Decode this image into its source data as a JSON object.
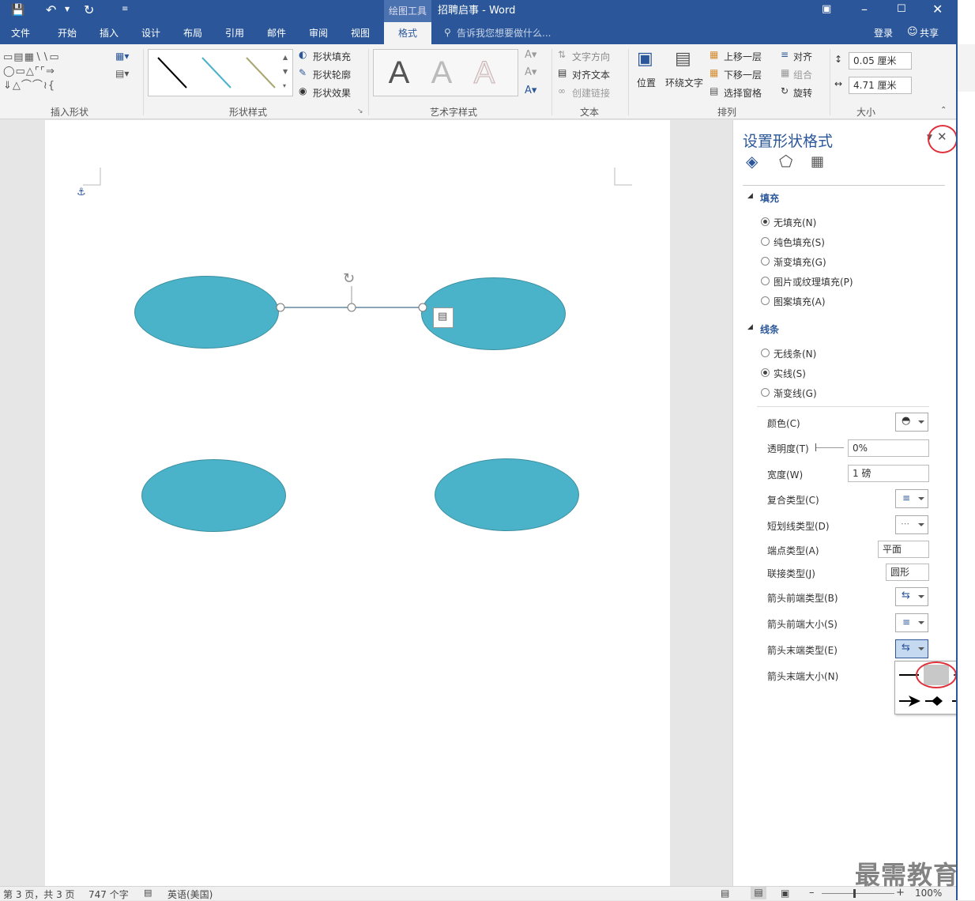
{
  "title": {
    "contextual_tool": "绘图工具",
    "document": "招聘启事 - Word"
  },
  "tabs": [
    "文件",
    "开始",
    "插入",
    "设计",
    "布局",
    "引用",
    "邮件",
    "审阅",
    "视图",
    "格式"
  ],
  "tell_me": "告诉我您想要做什么...",
  "account": {
    "login": "登录",
    "share": "共享"
  },
  "ribbon": {
    "groups": [
      "插入形状",
      "形状样式",
      "艺术字样式",
      "文本",
      "排列",
      "大小"
    ],
    "shape_fill": "形状填充",
    "shape_outline": "形状轮廓",
    "shape_effect": "形状效果",
    "text_direction": "文字方向",
    "align_text": "对齐文本",
    "create_link": "创建链接",
    "position": "位置",
    "wrap_text": "环绕文字",
    "bring_forward": "上移一层",
    "send_backward": "下移一层",
    "selection_pane": "选择窗格",
    "align": "对齐",
    "group": "组合",
    "rotate": "旋转",
    "height": "0.05 厘米",
    "width": "4.71 厘米",
    "wordart_letter": "A"
  },
  "pane": {
    "title": "设置形状格式",
    "fill_section": "填充",
    "fill_options": [
      "无填充(N)",
      "纯色填充(S)",
      "渐变填充(G)",
      "图片或纹理填充(P)",
      "图案填充(A)"
    ],
    "line_section": "线条",
    "line_options": [
      "无线条(N)",
      "实线(S)",
      "渐变线(G)"
    ],
    "props": {
      "color": "颜色(C)",
      "transparency": "透明度(T)",
      "transparency_val": "0%",
      "width": "宽度(W)",
      "width_val": "1 磅",
      "compound": "复合类型(C)",
      "dash": "短划线类型(D)",
      "cap": "端点类型(A)",
      "cap_val": "平面",
      "join": "联接类型(J)",
      "join_val": "圆形",
      "begin_type": "箭头前端类型(B)",
      "begin_size": "箭头前端大小(S)",
      "end_type": "箭头末端类型(E)",
      "end_size": "箭头末端大小(N)"
    }
  },
  "status": {
    "page": "第 3 页，共 3 页",
    "words": "747 个字",
    "lang": "英语(美国)",
    "zoom": "100%"
  },
  "watermark": "最需教育",
  "colors": {
    "accent": "#2b579a",
    "shape_fill": "#4bb3c9",
    "highlight": "#e0303a"
  }
}
